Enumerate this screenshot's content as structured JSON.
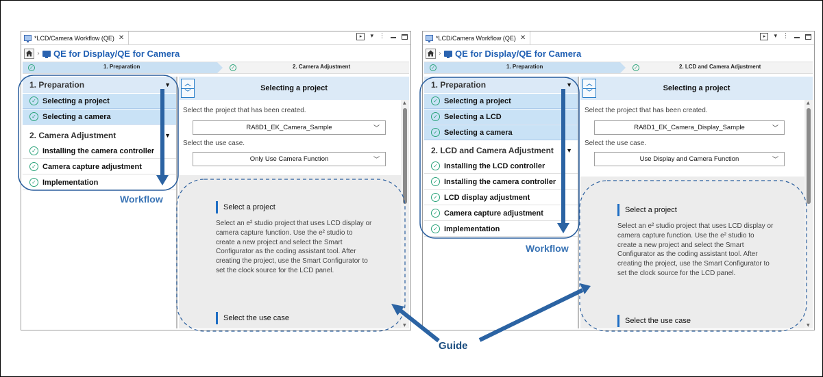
{
  "left": {
    "tab_title": "*LCD/Camera Workflow (QE)",
    "breadcrumb_title": "QE for Display/QE for Camera",
    "steps": [
      "1. Preparation",
      "2. Camera Adjustment"
    ],
    "sidebar": {
      "group1_title": "1. Preparation",
      "group1_items": [
        "Selecting a project",
        "Selecting a camera"
      ],
      "group2_title": "2. Camera Adjustment",
      "group2_items": [
        "Installing the camera controller",
        "Camera capture adjustment",
        "Implementation"
      ]
    },
    "content": {
      "header": "Selecting a project",
      "project_label": "Select the project that has been created.",
      "project_value": "RA8D1_EK_Camera_Sample",
      "usecase_label": "Select the use case.",
      "usecase_value": "Only Use Camera Function",
      "guide_heading1": "Select a project",
      "guide_text": "Select an e² studio project that uses LCD display or camera capture function. Use the e² studio to create a new project and select the Smart Configurator as the coding assistant tool. After creating the project, use the Smart Configurator to set the clock source for the LCD panel.",
      "guide_heading2": "Select the use case"
    }
  },
  "right": {
    "tab_title": "*LCD/Camera Workflow (QE)",
    "breadcrumb_title": "QE for Display/QE for Camera",
    "steps": [
      "1. Preparation",
      "2. LCD and Camera Adjustment"
    ],
    "sidebar": {
      "group1_title": "1. Preparation",
      "group1_items": [
        "Selecting a project",
        "Selecting a LCD",
        "Selecting a camera"
      ],
      "group2_title": "2. LCD and Camera Adjustment",
      "group2_items": [
        "Installing the LCD controller",
        "Installing the camera controller",
        "LCD display adjustment",
        "Camera capture adjustment",
        "Implementation"
      ]
    },
    "content": {
      "header": "Selecting a project",
      "project_label": "Select the project that has been created.",
      "project_value": "RA8D1_EK_Camera_Display_Sample",
      "usecase_label": "Select the use case.",
      "usecase_value": "Use Display and Camera Function",
      "guide_heading1": "Select a project",
      "guide_text": "Select an e² studio project that uses LCD display or camera capture function. Use the e² studio to create a new project and select the Smart Configurator as the coding assistant tool. After creating the project, use the Smart Configurator to set the clock source for the LCD panel.",
      "guide_heading2": "Select the use case"
    }
  },
  "annotations": {
    "workflow_left": "Workflow",
    "workflow_right": "Workflow",
    "guide": "Guide"
  },
  "colors": {
    "brand_blue": "#1f5fb3",
    "annotation_blue": "#3a74b5",
    "arrow_blue": "#2b63a3",
    "selected_row": "#c9e2f6",
    "check_green": "#2aa37a"
  }
}
